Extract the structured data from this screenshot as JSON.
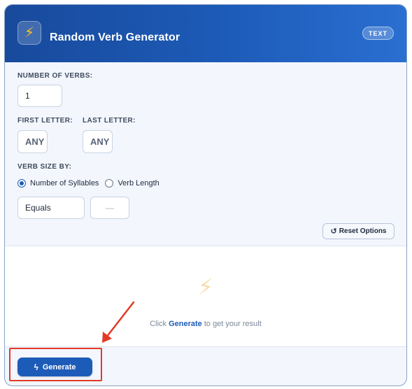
{
  "header": {
    "title": "Random Verb Generator",
    "badge": "TEXT",
    "logo_icon": "lightning-bolt-icon"
  },
  "form": {
    "num_verbs_label": "NUMBER OF VERBS:",
    "num_verbs_value": "1",
    "first_letter_label": "FIRST LETTER:",
    "first_letter_placeholder": "ANY",
    "last_letter_label": "LAST LETTER:",
    "last_letter_placeholder": "ANY",
    "verb_size_label": "VERB SIZE BY:",
    "size_options": [
      {
        "label": "Number of Syllables",
        "selected": true
      },
      {
        "label": "Verb Length",
        "selected": false
      }
    ],
    "comparator_value": "Equals",
    "size_value": "—",
    "reset_label": "Reset Options"
  },
  "result": {
    "hint_prefix": "Click",
    "hint_action": "Generate",
    "hint_suffix": "to get your result"
  },
  "footer": {
    "generate_label": "Generate"
  },
  "colors": {
    "accent": "#1d5bb8",
    "highlight": "#e23a26"
  }
}
